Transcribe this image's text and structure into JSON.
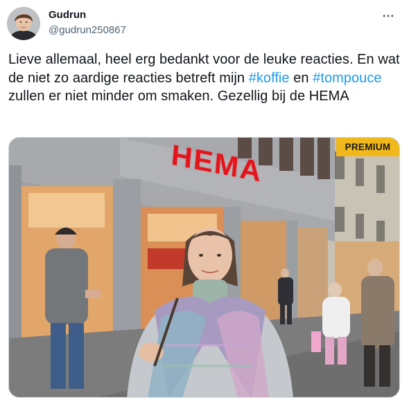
{
  "tweet": {
    "author": {
      "display_name": "Gudrun",
      "handle": "@gudrun250867",
      "avatar_icon": "avatar-photo"
    },
    "more_icon": "more-horizontal-icon",
    "text": {
      "part1": "Lieve allemaal, heel erg bedankt voor de leuke reacties. En wat de niet zo aardige reacties betreft mijn ",
      "hashtag1": "#koffie",
      "part2": " en ",
      "hashtag2": "#tompouce",
      "part3": " zullen er niet minder om smaken. Gezellig bij de HEMA"
    },
    "media": {
      "badge": "PREMIUM",
      "store_sign": "HEMA"
    }
  },
  "colors": {
    "text": "#0f1419",
    "secondary": "#536471",
    "link": "#1d9bf0",
    "badge": "#f0b81a",
    "sign": "#e3161d"
  }
}
